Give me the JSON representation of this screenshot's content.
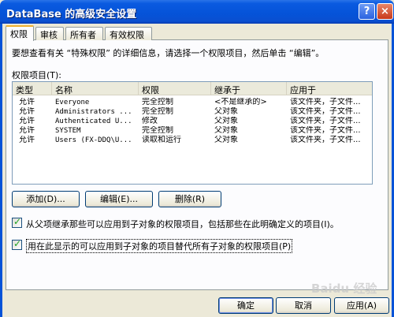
{
  "window": {
    "title": "DataBase 的高级安全设置",
    "help_icon": "?",
    "close_icon": "×"
  },
  "tabs": [
    {
      "label": "权限",
      "active": true
    },
    {
      "label": "审核"
    },
    {
      "label": "所有者"
    },
    {
      "label": "有效权限"
    }
  ],
  "info_text": "要想查看有关 “特殊权限” 的详细信息，请选择一个权限项目，然后单击 “编辑”。",
  "list_label": "权限项目(T):",
  "columns": [
    "类型",
    "名称",
    "权限",
    "继承于",
    "应用于"
  ],
  "rows": [
    {
      "type": "允许",
      "name": "Everyone",
      "permission": "完全控制",
      "inherited": "<不是继承的>",
      "applies": "该文件夹，子文件..."
    },
    {
      "type": "允许",
      "name": "Administrators ...",
      "permission": "完全控制",
      "inherited": "父对象",
      "applies": "该文件夹，子文件..."
    },
    {
      "type": "允许",
      "name": "Authenticated U...",
      "permission": "修改",
      "inherited": "父对象",
      "applies": "该文件夹，子文件..."
    },
    {
      "type": "允许",
      "name": "SYSTEM",
      "permission": "完全控制",
      "inherited": "父对象",
      "applies": "该文件夹，子文件..."
    },
    {
      "type": "允许",
      "name": "Users (FX-DDQ\\U...",
      "permission": "读取和运行",
      "inherited": "父对象",
      "applies": "该文件夹，子文件..."
    }
  ],
  "buttons": {
    "add": "添加(D)...",
    "edit": "编辑(E)...",
    "remove": "删除(R)"
  },
  "checkboxes": {
    "inherit": {
      "label": "从父项继承那些可以应用到子对象的权限项目，包括那些在此明确定义的项目(I)。",
      "checked": true
    },
    "replace": {
      "label": "用在此显示的可以应用到子对象的项目替代所有子对象的权限项目(P)",
      "checked": true
    }
  },
  "footer": {
    "ok": "确定",
    "cancel": "取消",
    "apply": "应用(A)"
  },
  "watermark": "Baidu 经验"
}
